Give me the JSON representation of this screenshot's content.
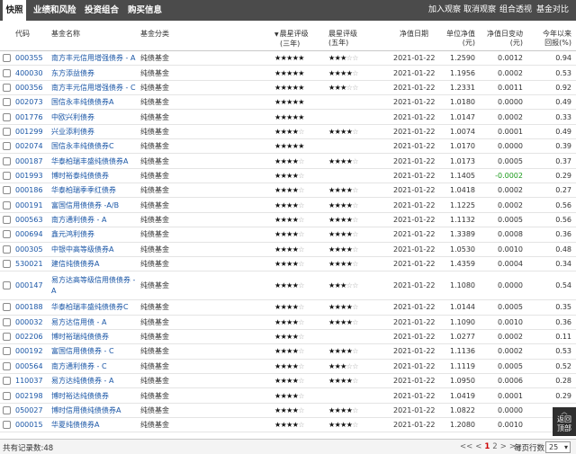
{
  "tabs": [
    {
      "label": "快照",
      "active": true
    },
    {
      "label": "业绩和风险",
      "active": false
    },
    {
      "label": "投资组合",
      "active": false
    },
    {
      "label": "购买信息",
      "active": false
    }
  ],
  "actions": [
    "加入观察",
    "取消观察",
    "组合透视",
    "基金对比"
  ],
  "columns": {
    "code": "代码",
    "name": "基金名称",
    "category": "基金分类",
    "rating3": [
      "晨星评级",
      "(三年)"
    ],
    "rating5": [
      "晨星评级",
      "(五年)"
    ],
    "date": "净值日期",
    "nav": [
      "单位净值",
      "(元)"
    ],
    "change": [
      "净值日变动",
      "(元)"
    ],
    "ytd": [
      "今年以来",
      "回报(%)"
    ]
  },
  "rows": [
    {
      "code": "000355",
      "name": "南方丰元信用增强债券 - A",
      "category": "纯债基金",
      "r3": 5,
      "r5": 3,
      "date": "2021-01-22",
      "nav": "1.2590",
      "change": "0.0012",
      "ytd": "0.94"
    },
    {
      "code": "400030",
      "name": "东方添益债券",
      "category": "纯债基金",
      "r3": 5,
      "r5": 4,
      "date": "2021-01-22",
      "nav": "1.1956",
      "change": "0.0002",
      "ytd": "0.53"
    },
    {
      "code": "000356",
      "name": "南方丰元信用增强债券 - C",
      "category": "纯债基金",
      "r3": 5,
      "r5": 3,
      "date": "2021-01-22",
      "nav": "1.2331",
      "change": "0.0011",
      "ytd": "0.92"
    },
    {
      "code": "002073",
      "name": "国信永丰纯债债券A",
      "category": "纯债基金",
      "r3": 5,
      "r5": 0,
      "date": "2021-01-22",
      "nav": "1.0180",
      "change": "0.0000",
      "ytd": "0.49"
    },
    {
      "code": "001776",
      "name": "中欧兴利债券",
      "category": "纯债基金",
      "r3": 5,
      "r5": 0,
      "date": "2021-01-22",
      "nav": "1.0147",
      "change": "0.0002",
      "ytd": "0.33"
    },
    {
      "code": "001299",
      "name": "兴业添利债券",
      "category": "纯债基金",
      "r3": 4,
      "r5": 4,
      "date": "2021-01-22",
      "nav": "1.0074",
      "change": "0.0001",
      "ytd": "0.49"
    },
    {
      "code": "002074",
      "name": "国信永丰纯债债券C",
      "category": "纯债基金",
      "r3": 5,
      "r5": 0,
      "date": "2021-01-22",
      "nav": "1.0170",
      "change": "0.0000",
      "ytd": "0.39"
    },
    {
      "code": "000187",
      "name": "华泰柏瑞丰盛纯债债券A",
      "category": "纯债基金",
      "r3": 4,
      "r5": 4,
      "date": "2021-01-22",
      "nav": "1.0173",
      "change": "0.0005",
      "ytd": "0.37"
    },
    {
      "code": "001993",
      "name": "博时裕泰纯债债券",
      "category": "纯债基金",
      "r3": 4,
      "r5": 0,
      "date": "2021-01-22",
      "nav": "1.1405",
      "change": "-0.0002",
      "ytd": "0.29",
      "neg": true
    },
    {
      "code": "000186",
      "name": "华泰柏瑞季季红债券",
      "category": "纯债基金",
      "r3": 4,
      "r5": 4,
      "date": "2021-01-22",
      "nav": "1.0418",
      "change": "0.0002",
      "ytd": "0.27"
    },
    {
      "code": "000191",
      "name": "富国信用债债券 -A/B",
      "category": "纯债基金",
      "r3": 4,
      "r5": 4,
      "date": "2021-01-22",
      "nav": "1.1225",
      "change": "0.0002",
      "ytd": "0.56"
    },
    {
      "code": "000563",
      "name": "南方通利债券 - A",
      "category": "纯债基金",
      "r3": 4,
      "r5": 4,
      "date": "2021-01-22",
      "nav": "1.1132",
      "change": "0.0005",
      "ytd": "0.56"
    },
    {
      "code": "000694",
      "name": "鑫元鸿利债券",
      "category": "纯债基金",
      "r3": 4,
      "r5": 4,
      "date": "2021-01-22",
      "nav": "1.3389",
      "change": "0.0008",
      "ytd": "0.36"
    },
    {
      "code": "000305",
      "name": "中银中高等级债券A",
      "category": "纯债基金",
      "r3": 4,
      "r5": 4,
      "date": "2021-01-22",
      "nav": "1.0530",
      "change": "0.0010",
      "ytd": "0.48"
    },
    {
      "code": "530021",
      "name": "建信纯债债券A",
      "category": "纯债基金",
      "r3": 4,
      "r5": 4,
      "date": "2021-01-22",
      "nav": "1.4359",
      "change": "0.0004",
      "ytd": "0.34"
    },
    {
      "code": "000147",
      "name": "易方达高等级信用债债券 - A",
      "category": "纯债基金",
      "r3": 4,
      "r5": 3,
      "date": "2021-01-22",
      "nav": "1.1080",
      "change": "0.0000",
      "ytd": "0.54",
      "tall": true
    },
    {
      "code": "000188",
      "name": "华泰柏瑞丰盛纯债债券C",
      "category": "纯债基金",
      "r3": 4,
      "r5": 4,
      "date": "2021-01-22",
      "nav": "1.0144",
      "change": "0.0005",
      "ytd": "0.35"
    },
    {
      "code": "000032",
      "name": "易方达信用债 - A",
      "category": "纯债基金",
      "r3": 4,
      "r5": 4,
      "date": "2021-01-22",
      "nav": "1.1090",
      "change": "0.0010",
      "ytd": "0.36"
    },
    {
      "code": "002206",
      "name": "博时裕瑞纯债债券",
      "category": "纯债基金",
      "r3": 4,
      "r5": 0,
      "date": "2021-01-22",
      "nav": "1.0277",
      "change": "0.0002",
      "ytd": "0.11"
    },
    {
      "code": "000192",
      "name": "富国信用债债券 - C",
      "category": "纯债基金",
      "r3": 4,
      "r5": 4,
      "date": "2021-01-22",
      "nav": "1.1136",
      "change": "0.0002",
      "ytd": "0.53"
    },
    {
      "code": "000564",
      "name": "南方通利债券 - C",
      "category": "纯债基金",
      "r3": 4,
      "r5": 3,
      "date": "2021-01-22",
      "nav": "1.1119",
      "change": "0.0005",
      "ytd": "0.52"
    },
    {
      "code": "110037",
      "name": "易方达纯债债券 - A",
      "category": "纯债基金",
      "r3": 4,
      "r5": 4,
      "date": "2021-01-22",
      "nav": "1.0950",
      "change": "0.0006",
      "ytd": "0.28"
    },
    {
      "code": "002198",
      "name": "博时裕达纯债债券",
      "category": "纯债基金",
      "r3": 4,
      "r5": 0,
      "date": "2021-01-22",
      "nav": "1.0419",
      "change": "0.0001",
      "ytd": "0.29"
    },
    {
      "code": "050027",
      "name": "博时信用债纯债债券A",
      "category": "纯债基金",
      "r3": 4,
      "r5": 4,
      "date": "2021-01-22",
      "nav": "1.0822",
      "change": "0.0000",
      "ytd": ""
    },
    {
      "code": "000015",
      "name": "华夏纯债债券A",
      "category": "纯债基金",
      "r3": 4,
      "r5": 4,
      "date": "2021-01-22",
      "nav": "1.2080",
      "change": "0.0010",
      "ytd": ""
    }
  ],
  "back_to_top": [
    "返回",
    "顶部"
  ],
  "footer": {
    "total": "共有记录数:48",
    "pager_prev": "<<",
    "pager_prev_one": "<",
    "pages": [
      "1",
      "2"
    ],
    "current_page": "1",
    "pager_next_one": ">",
    "pager_next": ">>",
    "per_page_label": "每页行数",
    "per_page_value": "25"
  },
  "colors": {
    "topbar": "#4b4b4b",
    "link": "#1a56a6",
    "negative": "#1b9a1b",
    "current_page": "#cc0000"
  }
}
